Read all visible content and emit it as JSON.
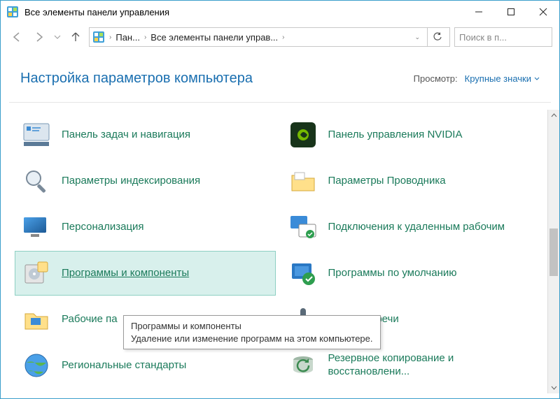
{
  "window": {
    "title": "Все элементы панели управления"
  },
  "address": {
    "seg1": "Пан...",
    "seg2": "Все элементы панели управ..."
  },
  "search": {
    "placeholder": "Поиск в п..."
  },
  "heading": "Настройка параметров компьютера",
  "view": {
    "label": "Просмотр:",
    "value": "Крупные значки"
  },
  "items": [
    {
      "label": "Панель задач и навигация"
    },
    {
      "label": "Панель управления NVIDIA"
    },
    {
      "label": "Параметры индексирования"
    },
    {
      "label": "Параметры Проводника"
    },
    {
      "label": "Персонализация"
    },
    {
      "label": "Подключения к удаленным рабочим"
    },
    {
      "label": "Программы и компоненты"
    },
    {
      "label": "Программы по умолчанию"
    },
    {
      "label": "Рабочие па"
    },
    {
      "label": "знавание речи"
    },
    {
      "label": "Региональные стандарты"
    },
    {
      "label": "Резервное копирование и восстановлени..."
    }
  ],
  "tooltip": {
    "title": "Программы и компоненты",
    "body": "Удаление или изменение программ на этом компьютере."
  }
}
